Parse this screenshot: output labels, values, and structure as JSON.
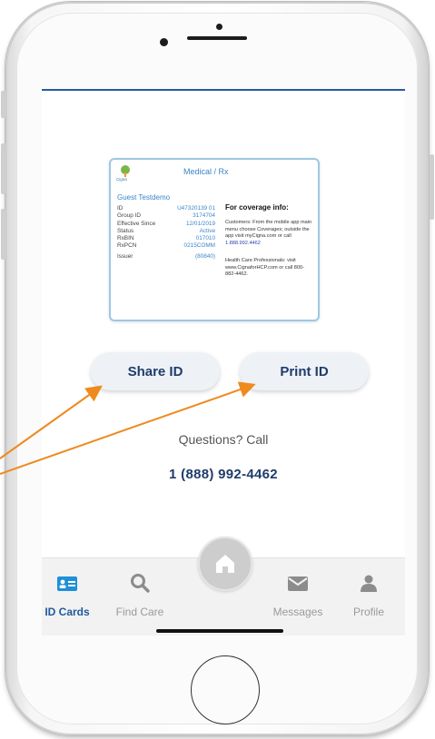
{
  "card": {
    "brand": "Cigna",
    "plan": "Medical / Rx",
    "member_name": "Guest Testdemo",
    "fields": [
      {
        "label": "ID",
        "value": "U47320139 01"
      },
      {
        "label": "Group ID",
        "value": "3174704"
      },
      {
        "label": "Effective Since",
        "value": "12/01/2019"
      },
      {
        "label": "Status",
        "value": "Active"
      },
      {
        "label": "RxBIN",
        "value": "017010"
      },
      {
        "label": "RxPCN",
        "value": "0215COMM"
      },
      {
        "label": "Issuer",
        "value": "(80840)"
      }
    ],
    "coverage_title": "For coverage info:",
    "coverage_customers": "Customers: From the mobile app main menu choose Coverages; outside the app visit myCigna.com or call",
    "coverage_phone": "1.888.992.4462",
    "coverage_hcp": "Health Care Professionals: visit www.CignaforHCP.com or call 800-882-4462."
  },
  "actions": {
    "share_label": "Share ID",
    "print_label": "Print ID"
  },
  "contact": {
    "questions_text": "Questions? Call",
    "phone": "1 (888) 992-4462"
  },
  "tabs": [
    {
      "label": "ID Cards",
      "icon": "id-card-icon",
      "active": true
    },
    {
      "label": "Find Care",
      "icon": "search-icon",
      "active": false
    },
    {
      "label": "",
      "icon": "home-icon",
      "active": false
    },
    {
      "label": "Messages",
      "icon": "envelope-icon",
      "active": false
    },
    {
      "label": "Profile",
      "icon": "person-icon",
      "active": false
    }
  ],
  "colors": {
    "accent": "#1f5a9c",
    "arrow": "#ee8a1e",
    "card_border": "#9ec8e4"
  }
}
